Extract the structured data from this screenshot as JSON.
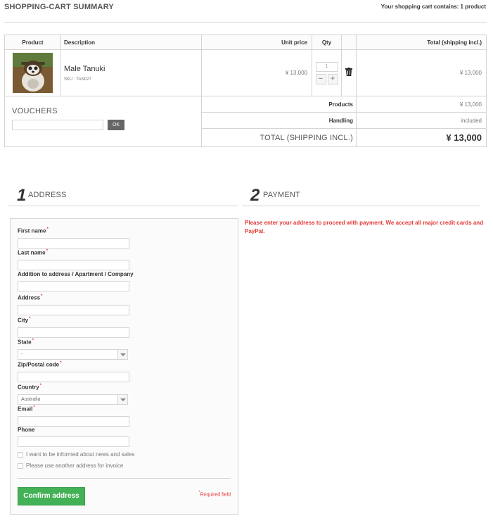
{
  "header": {
    "title": "SHOPPING-CART SUMMARY",
    "count_text": "Your shopping cart contains: 1 product"
  },
  "table": {
    "columns": {
      "product": "Product",
      "description": "Description",
      "unit_price": "Unit price",
      "qty": "Qty",
      "total": "Total (shipping incl.)"
    },
    "item": {
      "name": "Male Tanuki",
      "sku": "SKU : TAN027",
      "unit_price": "¥ 13,000",
      "qty": "1",
      "total": "¥ 13,000",
      "minus": "−",
      "plus": "+"
    },
    "vouchers": {
      "title": "VOUCHERS",
      "ok_label": "OK"
    },
    "summary": {
      "products_label": "Products",
      "products_value": "¥ 13,000",
      "handling_label": "Handling",
      "handling_value": "included",
      "total_label": "TOTAL (SHIPPING INCL.)",
      "total_value": "¥ 13,000"
    }
  },
  "steps": {
    "address": {
      "num": "1",
      "label": "ADDRESS"
    },
    "payment": {
      "num": "2",
      "label": "PAYMENT"
    }
  },
  "payment_message": "Please enter your address to proceed with payment. We accept all major credit cards and PayPal.",
  "address_form": {
    "first_name": "First name",
    "last_name": "Last name",
    "addition": "Addition to address / Apartment / Company",
    "address": "Address",
    "city": "City",
    "state": "State",
    "state_value": "-",
    "zip": "Zip/Postal code",
    "country": "Country",
    "country_value": "Australia",
    "email": "Email",
    "phone": "Phone",
    "newsletter": "I want to be informed about news and sales",
    "invoice_address": "Please use another address for invoice",
    "confirm_label": "Confirm address",
    "required_mark": "*",
    "required_note": "Required field"
  },
  "colors": {
    "accent_green": "#43b155",
    "error_red": "#e53935"
  }
}
